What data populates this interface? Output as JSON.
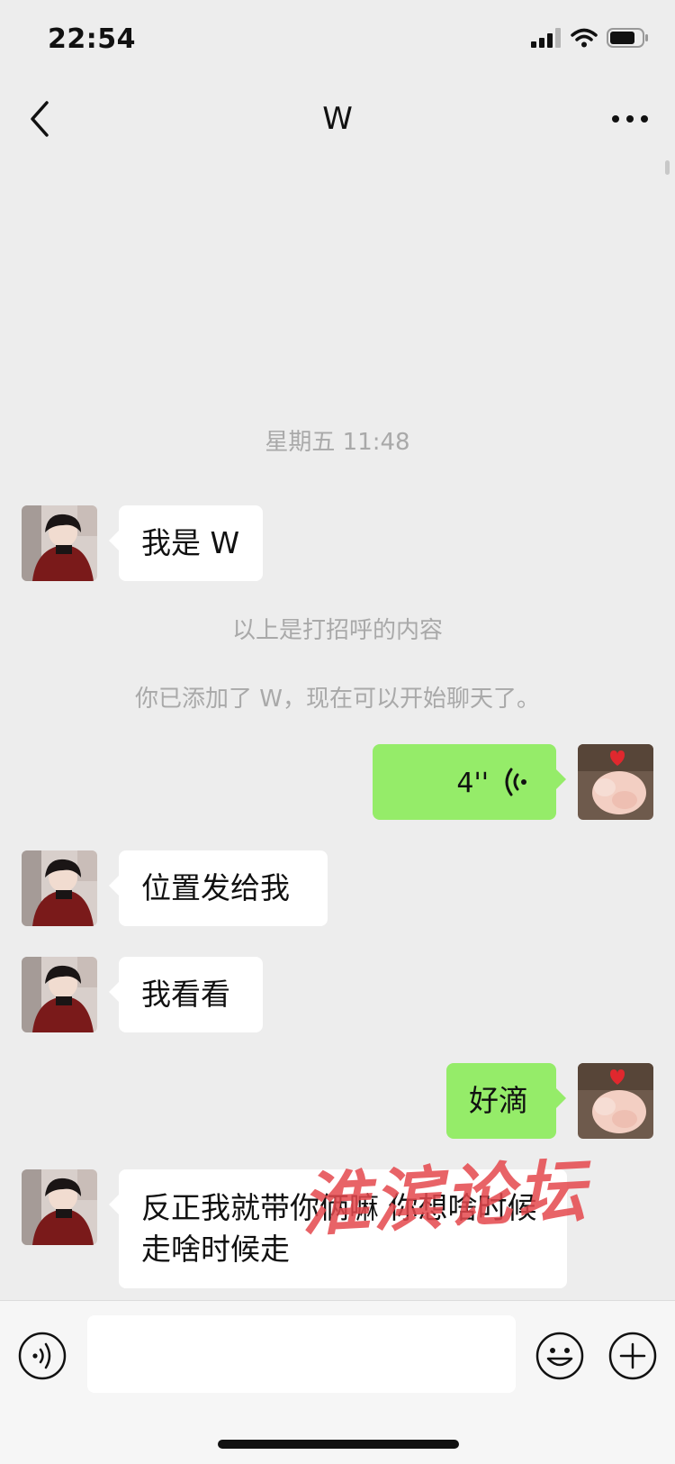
{
  "status_bar": {
    "time": "22:54"
  },
  "header": {
    "title": "W"
  },
  "messages": {
    "timestamp": "星期五 11:48",
    "m1": "我是 W",
    "sys1": "以上是打招呼的内容",
    "sys2": "你已添加了 W，现在可以开始聊天了。",
    "voice_duration": "4''",
    "m3": "位置发给我",
    "m4": "我看看",
    "m5": "好滴",
    "m6": "反正我就带你俩嘛 你想啥时候走啥时候走"
  },
  "watermark": "淮滨论坛",
  "input": {
    "placeholder": ""
  },
  "colors": {
    "background": "#ededed",
    "outgoing_bubble": "#95ec69",
    "incoming_bubble": "#ffffff",
    "system_text": "#a9a9a9",
    "watermark": "#e5484d"
  },
  "icons": [
    "back-icon",
    "more-icon",
    "voice-wave-icon",
    "voice-mode-icon",
    "emoji-icon",
    "plus-icon",
    "signal-icon",
    "wifi-icon",
    "battery-icon"
  ]
}
